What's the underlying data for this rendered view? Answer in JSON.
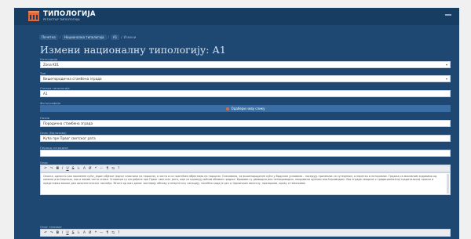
{
  "brand": {
    "name": "ТИПОЛОГИЈА",
    "tagline": "РЕГИСТАР ТИПОЛОГИЈА"
  },
  "breadcrumb": [
    "Почетна",
    "Национална типологија",
    "А1",
    "Измени"
  ],
  "page_title": "Измени националну типологију: А1",
  "fields": [
    {
      "label": "Категорија",
      "value": "Zona K01",
      "type": "select"
    },
    {
      "label": "Тип",
      "value": "Вишепородична стамбена зграда",
      "type": "select"
    },
    {
      "label": "Ознака типологије",
      "value": "А1",
      "type": "text"
    }
  ],
  "upload": {
    "label": "Фотографија",
    "button": "Одабери нову слику"
  },
  "fields2": [
    {
      "label": "Назив",
      "value": "Породична стамбена зграда"
    },
    {
      "label": "Опис (Ефлазиво)",
      "value": "Кућа пре Првог светског рата"
    },
    {
      "label": "Период изградње",
      "value": ""
    }
  ],
  "editor1": {
    "label": "Опис",
    "toolbar": [
      "↶",
      "↷",
      "B",
      "I",
      "U",
      "S",
      "Iₓ",
      "A",
      "Ø",
      "❝",
      "—",
      "¶",
      "⇆",
      "?"
    ],
    "text": "Сеоска, односно као приземне куће, један објекат једног власника на парцели, а често и са пратећим објектима на парцели. Очекивано, за вишепородичне куће у брдским условима – поседују приземље са сутереном, а неретко и поткровље. Градња са масивним зидовима од камена или ћерпича, као и веома често опеке. Углавном су изграђене пре Првог светског рата, које се одликују већим обимом градње. Кровови су двоводни или четвороводни, покривени црепом или ћерамидом. Ова зграда сведочи о традиционалној градитељској пракси и представља важан део архитектонског наслеђа. Многе од њих данас захтевају обнову и енергетску санацију, посебно када је реч о термичком омотачу, прозорима, крову и темељима."
  },
  "editor2": {
    "label": "Опис технике",
    "toolbar": [
      "↶",
      "↷",
      "B",
      "I",
      "U",
      "S",
      "Iₓ",
      "A",
      "Ø",
      "❝",
      "—",
      "¶",
      "⇆",
      "?"
    ]
  }
}
